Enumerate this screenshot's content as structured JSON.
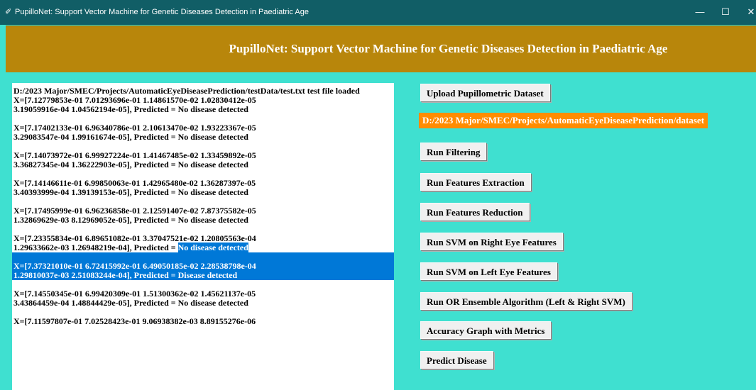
{
  "window": {
    "title": "PupilloNet: Support Vector Machine for Genetic Diseases Detection in Paediatric Age",
    "minimize_glyph": "—",
    "maximize_glyph": "☐",
    "close_glyph": "✕"
  },
  "header": {
    "title": "PupilloNet: Support Vector Machine for Genetic Diseases Detection in Paediatric Age"
  },
  "output": {
    "loaded_line": "D:/2023 Major/SMEC/Projects/AutomaticEyeDiseasePrediction/testData/test.txt test file loaded",
    "entries": [
      {
        "line1": "X=[7.12779853e-01 7.01293696e-01 1.14861570e-02 1.02830412e-05",
        "line2": " 3.19059916e-04 1.04562194e-05], Predicted = No disease detected"
      },
      {
        "line1": "X=[7.17402133e-01 6.96340786e-01 2.10613470e-02 1.93223367e-05",
        "line2": " 3.29083547e-04 1.99161674e-05], Predicted = No disease detected"
      },
      {
        "line1": "X=[7.14073972e-01 6.99927224e-01 1.41467485e-02 1.33459892e-05",
        "line2": " 3.36827345e-04 1.36222903e-05], Predicted = No disease detected"
      },
      {
        "line1": "X=[7.14146611e-01 6.99850063e-01 1.42965480e-02 1.36287397e-05",
        "line2": " 3.40393999e-04 1.39139153e-05], Predicted = No disease detected"
      },
      {
        "line1": "X=[7.17495999e-01 6.96236858e-01 2.12591407e-02 7.87375582e-05",
        "line2": " 1.32869629e-03 8.12969052e-05], Predicted = No disease detected"
      },
      {
        "line1": "X=[7.23355834e-01 6.89651082e-01 3.37047521e-02 1.20805563e-04",
        "line2_prefix": " 1.29633662e-03 1.26948219e-04], Predicted = ",
        "line2_selected": "No disease detected"
      },
      {
        "line1": "X=[7.37321010e-01 6.72415992e-01 6.49050185e-02 2.28538798e-04",
        "line2": " 1.29810037e-03 2.51083244e-04], Predicted = Disease detected"
      },
      {
        "line1": "X=[7.14550345e-01 6.99420309e-01 1.51300362e-02 1.45621137e-05",
        "line2": " 3.43864459e-04 1.48844429e-05], Predicted = No disease detected"
      },
      {
        "line1": "X=[7.11597807e-01 7.02528423e-01 9.06938382e-03 8.89155276e-06"
      }
    ]
  },
  "controls": {
    "upload_label": "Upload Pupillometric Dataset",
    "dataset_path": "D:/2023 Major/SMEC/Projects/AutomaticEyeDiseasePrediction/dataset",
    "filtering_label": "Run Filtering",
    "extraction_label": "Run Features Extraction",
    "reduction_label": "Run Features Reduction",
    "svm_right_label": "Run SVM on Right Eye Features",
    "svm_left_label": "Run SVM on Left Eye Features",
    "ensemble_label": "Run OR Ensemble Algorithm (Left & Right SVM)",
    "accuracy_label": "Accuracy Graph with Metrics",
    "predict_label": "Predict Disease"
  },
  "colors": {
    "background": "#3fe0d0",
    "header": "#b8860b",
    "titlebar": "#115e66",
    "path_label": "#ff8c00",
    "selection": "#0078d7"
  }
}
